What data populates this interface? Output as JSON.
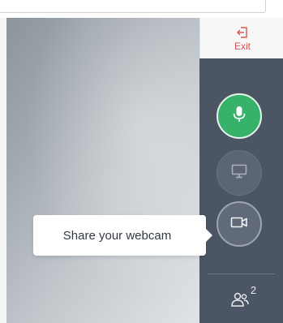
{
  "toolbar": {
    "exit_label": "Exit"
  },
  "sidebar": {
    "mic": {
      "icon": "microphone-icon",
      "state": "on"
    },
    "screen_share": {
      "icon": "monitor-icon"
    },
    "webcam": {
      "icon": "video-camera-icon"
    },
    "users": {
      "icon": "users-icon",
      "count": "2"
    }
  },
  "tooltip": {
    "text": "Share your webcam"
  },
  "colors": {
    "exit": "#d9534f",
    "mic_active": "#36b26a",
    "sidebar_bg": "#4c5563"
  }
}
